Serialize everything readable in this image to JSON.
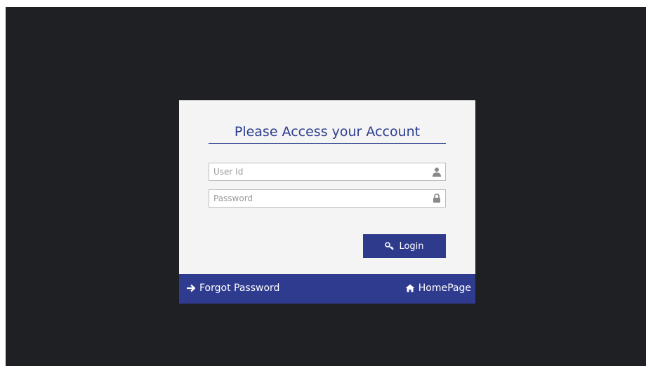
{
  "login": {
    "title": "Please Access your Account",
    "userid_placeholder": "User Id",
    "userid_value": "",
    "password_placeholder": "Password",
    "password_value": "",
    "login_label": "Login"
  },
  "footer": {
    "forgot_label": "Forgot Password",
    "home_label": "HomePage"
  },
  "icons": {
    "userid": "user-icon",
    "password": "lock-icon",
    "login": "key-icon",
    "forgot": "arrow-right-icon",
    "home": "home-icon"
  },
  "colors": {
    "background": "#1f2024",
    "card": "#f4f4f4",
    "accent": "#2e3a8c",
    "title": "#2e3f8f"
  }
}
